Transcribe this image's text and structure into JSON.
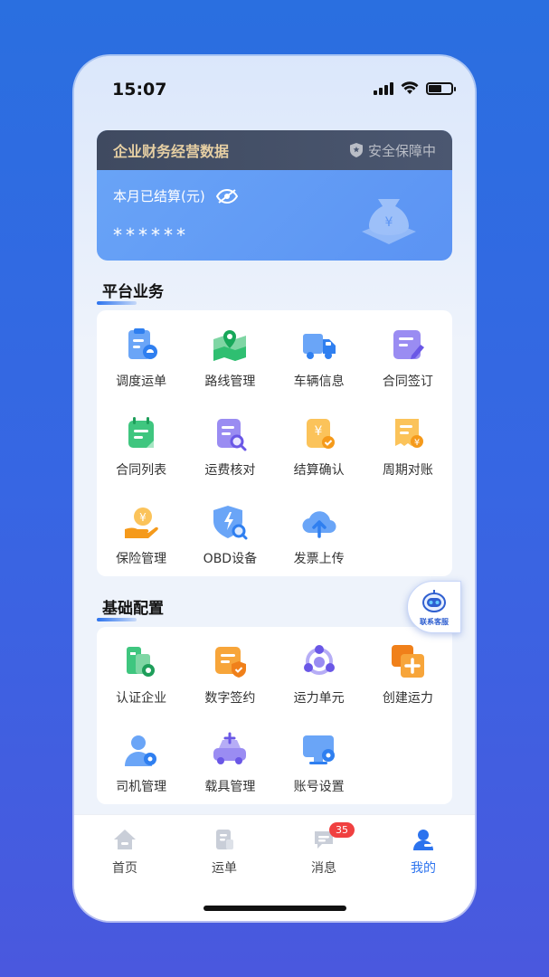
{
  "status_bar": {
    "time": "15:07"
  },
  "finance": {
    "title": "企业财务经营数据",
    "secure_label": "安全保障中",
    "settled_label": "本月已结算(元)",
    "amount_masked": "******"
  },
  "platform": {
    "title": "平台业务",
    "items": [
      {
        "label": "调度运单",
        "icon": "dispatch-order-icon"
      },
      {
        "label": "路线管理",
        "icon": "route-map-icon"
      },
      {
        "label": "车辆信息",
        "icon": "truck-icon"
      },
      {
        "label": "合同签订",
        "icon": "contract-sign-icon"
      },
      {
        "label": "合同列表",
        "icon": "contract-list-icon"
      },
      {
        "label": "运费核对",
        "icon": "freight-check-icon"
      },
      {
        "label": "结算确认",
        "icon": "settlement-confirm-icon"
      },
      {
        "label": "周期对账",
        "icon": "period-reconcile-icon"
      },
      {
        "label": "保险管理",
        "icon": "insurance-icon"
      },
      {
        "label": "OBD设备",
        "icon": "obd-device-icon"
      },
      {
        "label": "发票上传",
        "icon": "invoice-upload-icon"
      }
    ]
  },
  "basic": {
    "title": "基础配置",
    "items": [
      {
        "label": "认证企业",
        "icon": "certified-company-icon"
      },
      {
        "label": "数字签约",
        "icon": "digital-sign-icon"
      },
      {
        "label": "运力单元",
        "icon": "capacity-unit-icon"
      },
      {
        "label": "创建运力",
        "icon": "create-capacity-icon"
      },
      {
        "label": "司机管理",
        "icon": "driver-icon"
      },
      {
        "label": "载具管理",
        "icon": "vehicle-icon"
      },
      {
        "label": "账号设置",
        "icon": "account-settings-icon"
      }
    ]
  },
  "service": {
    "label": "联系客服"
  },
  "tabbar": {
    "items": [
      {
        "label": "首页",
        "icon": "home-icon"
      },
      {
        "label": "运单",
        "icon": "waybill-icon"
      },
      {
        "label": "消息",
        "icon": "message-icon",
        "badge": "35"
      },
      {
        "label": "我的",
        "icon": "profile-icon",
        "active": true
      }
    ]
  },
  "colors": {
    "accent": "#2c73ee",
    "badge": "#f04040",
    "finance_head": "#3f4a60",
    "finance_title": "#e6cfa3"
  }
}
